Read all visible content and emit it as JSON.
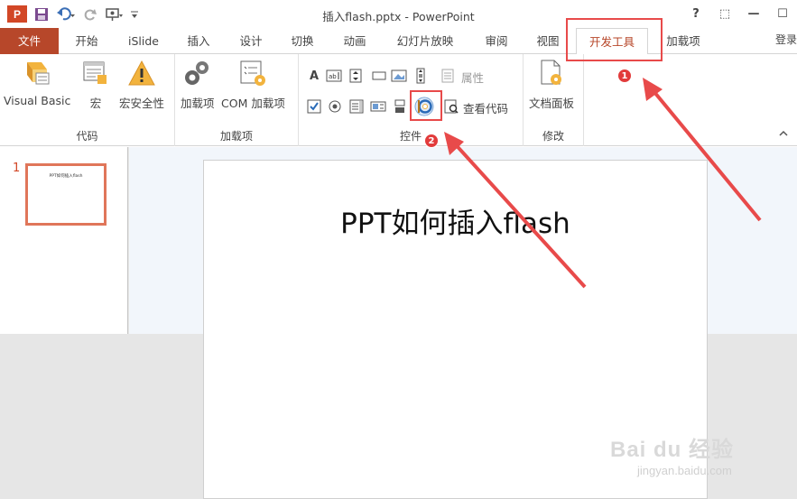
{
  "window": {
    "title": "插入flash.pptx - PowerPoint",
    "app_logo_letter": "P",
    "help": "?",
    "ribbon_display": "⬚",
    "minimize": "—",
    "maximize": "☐",
    "sign_in": "登录"
  },
  "tabs": [
    {
      "label": "文件"
    },
    {
      "label": "开始"
    },
    {
      "label": "iSlide"
    },
    {
      "label": "插入"
    },
    {
      "label": "设计"
    },
    {
      "label": "切换"
    },
    {
      "label": "动画"
    },
    {
      "label": "幻灯片放映"
    },
    {
      "label": "审阅"
    },
    {
      "label": "视图"
    },
    {
      "label": "开发工具"
    },
    {
      "label": "加载项"
    }
  ],
  "ribbon": {
    "groups": {
      "code": {
        "label": "代码",
        "visual_basic": "Visual Basic",
        "macro": "宏",
        "macro_security": "宏安全性"
      },
      "addins": {
        "label": "加载项",
        "addins_btn": "加载项",
        "com_addins": "COM 加载项"
      },
      "controls": {
        "label": "控件",
        "properties": "属性",
        "view_code": "查看代码"
      },
      "modify": {
        "label": "修改",
        "document_panel": "文档面板"
      }
    }
  },
  "thumbnails": {
    "slide_number": "1",
    "thumb_title": "PPT如何插入flash"
  },
  "slide": {
    "title": "PPT如何插入flash"
  },
  "annotations": {
    "badge1": "1",
    "badge2": "2"
  },
  "watermark": {
    "brand": "Bai du 经验",
    "domain": "jingyan.baidu.com"
  },
  "colors": {
    "accent": "#b7472a",
    "highlight": "#e84a4a"
  }
}
